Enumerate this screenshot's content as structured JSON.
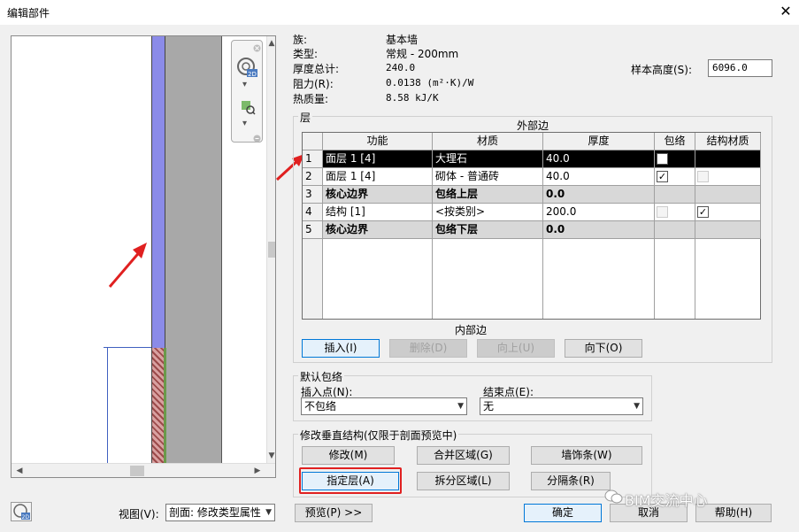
{
  "window": {
    "title": "编辑部件",
    "close_glyph": "✕"
  },
  "info": {
    "family_label": "族:",
    "family_value": "基本墙",
    "type_label": "类型:",
    "type_value": "常规 - 200mm",
    "thickness_label": "厚度总计:",
    "thickness_value": "240.0",
    "resistance_label": "阻力(R):",
    "resistance_value": "0.0138 (m²·K)/W",
    "thermal_label": "热质量:",
    "thermal_value": "8.58 kJ/K",
    "sample_height_label": "样本高度(S):",
    "sample_height_value": "6096.0"
  },
  "layers": {
    "group_title": "层",
    "exterior_label": "外部边",
    "interior_label": "内部边",
    "columns": [
      "功能",
      "材质",
      "厚度",
      "包络",
      "结构材质"
    ],
    "rows": [
      {
        "num": "1",
        "function": "面层 1 [4]",
        "material": "大理石",
        "thickness": "40.0",
        "wrap": "checked",
        "structural": "filled",
        "style": "selected"
      },
      {
        "num": "2",
        "function": "面层 1 [4]",
        "material": "砌体 - 普通砖",
        "thickness": "40.0",
        "wrap": "checked",
        "structural": "disabled",
        "style": "normal"
      },
      {
        "num": "3",
        "function": "核心边界",
        "material": "包络上层",
        "thickness": "0.0",
        "wrap": "none",
        "structural": "none",
        "style": "gray"
      },
      {
        "num": "4",
        "function": "结构 [1]",
        "material": "<按类别>",
        "thickness": "200.0",
        "wrap": "disabled",
        "structural": "checked",
        "style": "normal"
      },
      {
        "num": "5",
        "function": "核心边界",
        "material": "包络下层",
        "thickness": "0.0",
        "wrap": "none",
        "structural": "none",
        "style": "gray"
      }
    ],
    "buttons": {
      "insert": "插入(I)",
      "delete": "删除(D)",
      "up": "向上(U)",
      "down": "向下(O)"
    }
  },
  "default_wrap": {
    "group_title": "默认包络",
    "insert_label": "插入点(N):",
    "insert_value": "不包络",
    "end_label": "结束点(E):",
    "end_value": "无"
  },
  "modify_vertical": {
    "group_title": "修改垂直结构(仅限于剖面预览中)",
    "buttons": {
      "modify": "修改(M)",
      "merge": "合并区域(G)",
      "sweep": "墙饰条(W)",
      "assign": "指定层(A)",
      "split": "拆分区域(L)",
      "reveal": "分隔条(R)"
    }
  },
  "footer": {
    "view_label": "视图(V):",
    "view_value": "剖面: 修改类型属性",
    "preview_button": "预览(P) >>",
    "ok_button": "确定",
    "cancel_button": "取消",
    "help_button": "帮助(H)"
  },
  "watermark": "BIM交流中心",
  "colors": {
    "accent": "#0078d7",
    "annotation_red": "#e02020",
    "wall_blue": "#8b8be8"
  }
}
